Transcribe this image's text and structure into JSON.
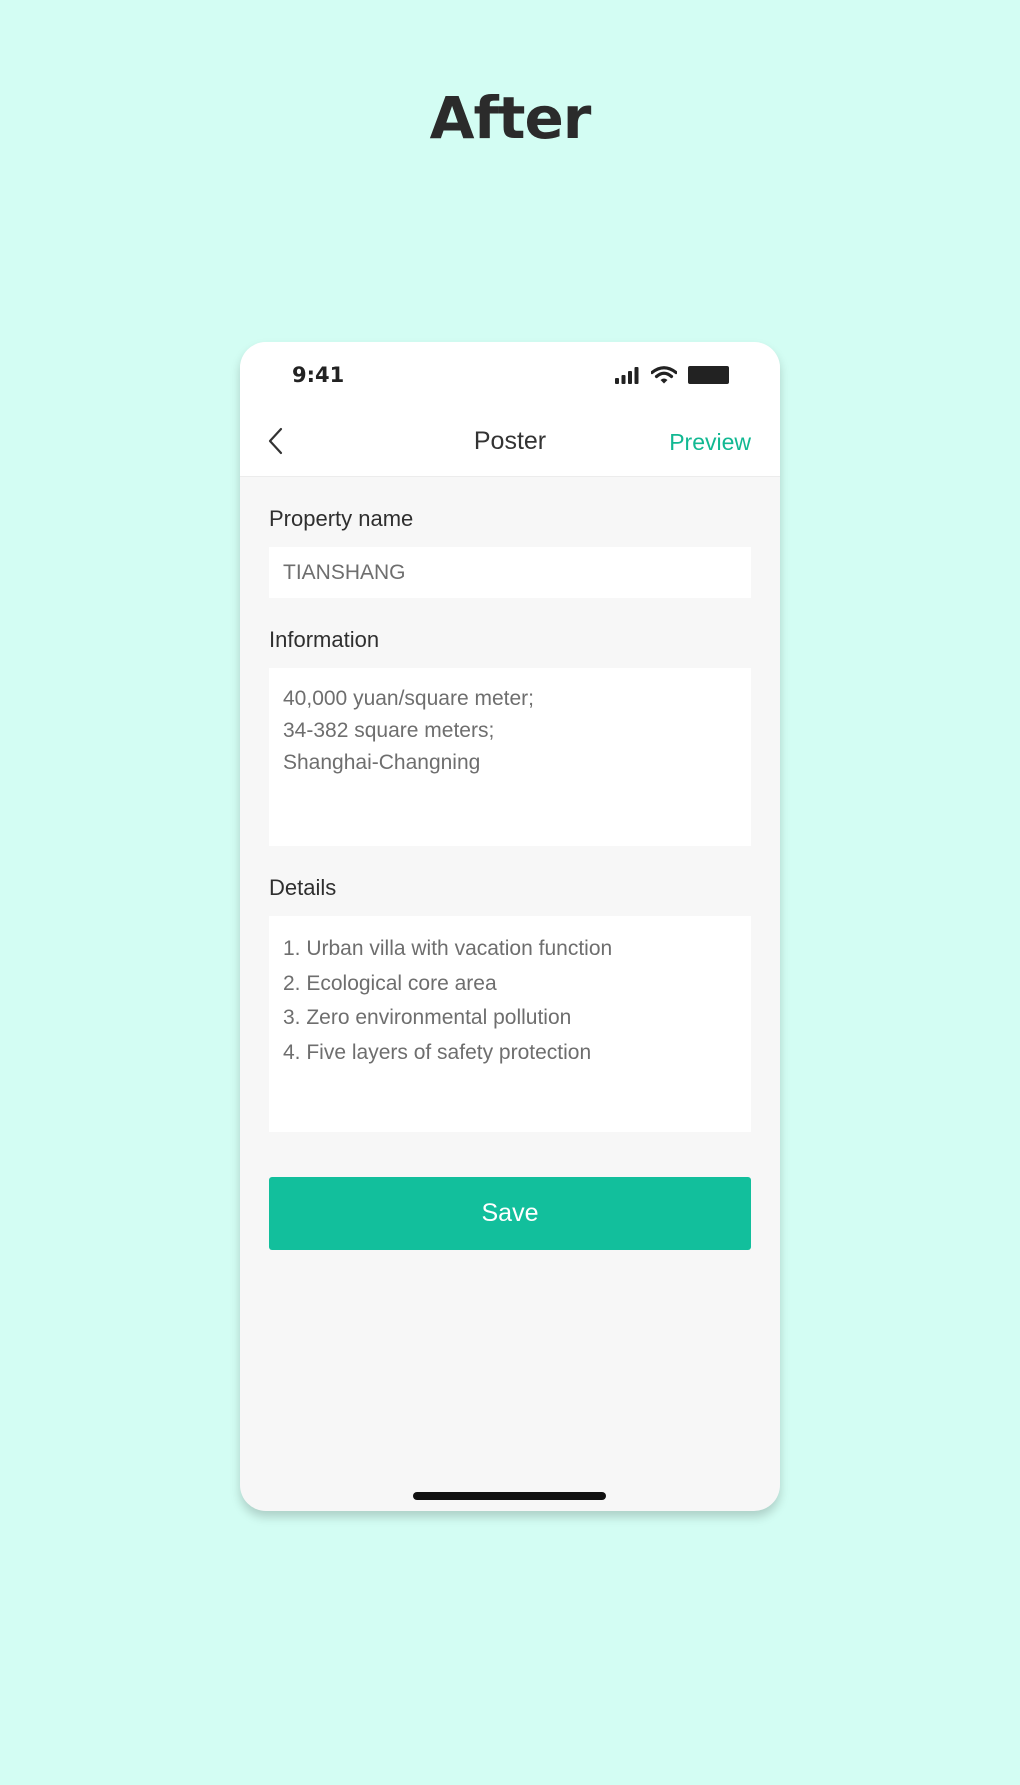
{
  "heading": "After",
  "status_bar": {
    "time": "9:41"
  },
  "nav": {
    "title": "Poster",
    "preview_label": "Preview"
  },
  "form": {
    "property_name": {
      "label": "Property name",
      "value": "TIANSHANG"
    },
    "information": {
      "label": "Information",
      "lines": [
        "40,000 yuan/square meter;",
        "34-382 square meters;",
        "Shanghai-Changning"
      ]
    },
    "details": {
      "label": "Details",
      "lines": [
        "1. Urban villa with vacation function",
        "2. Ecological core area",
        "3. Zero environmental pollution",
        "4. Five layers of safety protection"
      ]
    },
    "save_label": "Save"
  },
  "colors": {
    "background": "#d3fdf3",
    "accent": "#12bf9c",
    "preview_text": "#12b892"
  }
}
